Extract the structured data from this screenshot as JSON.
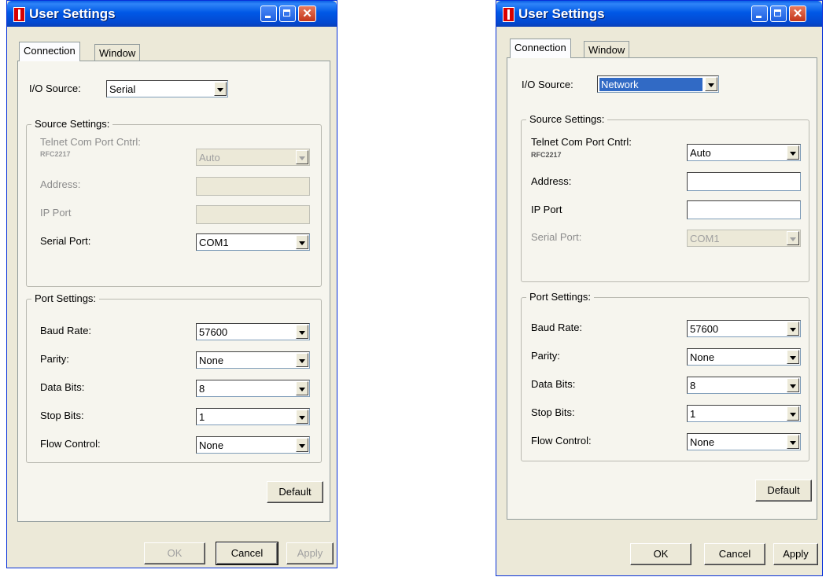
{
  "dialogs": [
    {
      "title": "User Settings",
      "tabs": [
        "Connection",
        "Window"
      ],
      "io_source_label": "I/O Source:",
      "io_source_value": "Serial",
      "source_settings_title": "Source Settings:",
      "telnet_label": "Telnet Com Port Cntrl:",
      "rfc_label": "RFC2217",
      "telnet_value": "Auto",
      "address_label": "Address:",
      "ip_port_label": "IP Port",
      "serial_port_label": "Serial Port:",
      "serial_port_value": "COM1",
      "port_settings_title": "Port Settings:",
      "baud_rate_label": "Baud Rate:",
      "baud_rate_value": "57600",
      "parity_label": "Parity:",
      "parity_value": "None",
      "data_bits_label": "Data Bits:",
      "data_bits_value": "8",
      "stop_bits_label": "Stop Bits:",
      "stop_bits_value": "1",
      "flow_control_label": "Flow Control:",
      "flow_control_value": "None",
      "default_button": "Default",
      "ok_button": "OK",
      "cancel_button": "Cancel",
      "apply_button": "Apply"
    },
    {
      "title": "User Settings",
      "tabs": [
        "Connection",
        "Window"
      ],
      "io_source_label": "I/O Source:",
      "io_source_value": "Network",
      "source_settings_title": "Source Settings:",
      "telnet_label": "Telnet Com Port Cntrl:",
      "rfc_label": "RFC2217",
      "telnet_value": "Auto",
      "address_label": "Address:",
      "ip_port_label": "IP Port",
      "serial_port_label": "Serial Port:",
      "serial_port_value": "COM1",
      "port_settings_title": "Port Settings:",
      "baud_rate_label": "Baud Rate:",
      "baud_rate_value": "57600",
      "parity_label": "Parity:",
      "parity_value": "None",
      "data_bits_label": "Data Bits:",
      "data_bits_value": "8",
      "stop_bits_label": "Stop Bits:",
      "stop_bits_value": "1",
      "flow_control_label": "Flow Control:",
      "flow_control_value": "None",
      "default_button": "Default",
      "ok_button": "OK",
      "cancel_button": "Cancel",
      "apply_button": "Apply"
    }
  ],
  "colors": {
    "title_bar": "#0058e6",
    "dialog_bg": "#ece9d8",
    "close_button": "#c3361b",
    "selection": "#316ac5"
  },
  "icons": [
    "app-icon",
    "minimize-icon",
    "maximize-icon",
    "close-icon",
    "chevron-down-icon"
  ]
}
